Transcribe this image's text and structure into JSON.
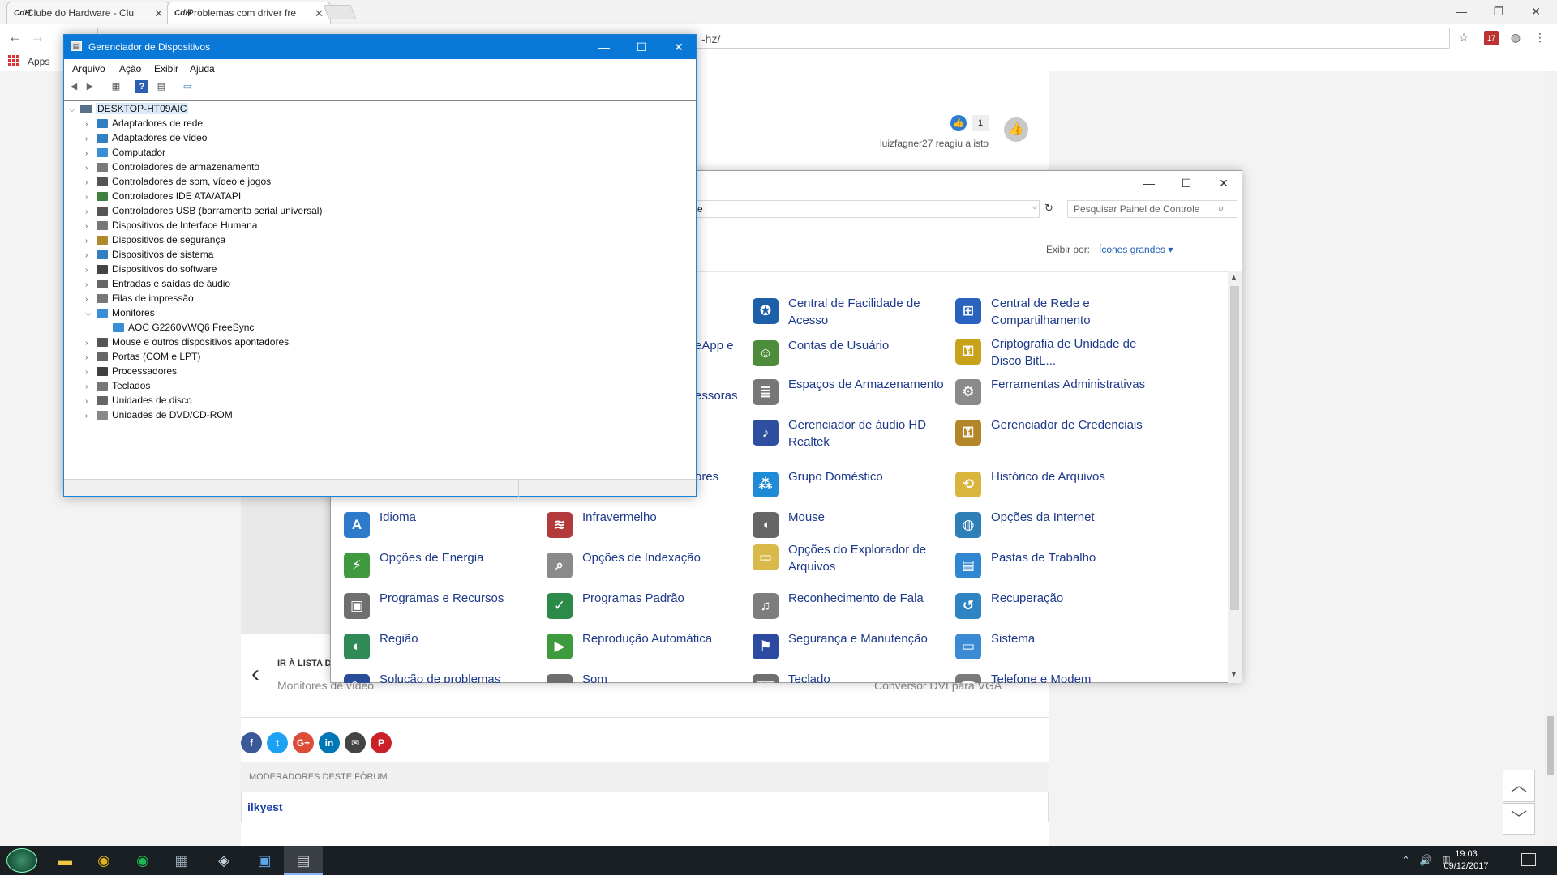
{
  "browser": {
    "tabs": [
      {
        "favicon": "CdH",
        "label": "Clube do Hardware - Clu"
      },
      {
        "favicon": "CdH",
        "label": "Problemas com driver fre"
      }
    ],
    "url_tail": "-hz/",
    "bookmarks_apps": "Apps",
    "extension_badge": "17"
  },
  "forum": {
    "reaction_count": "1",
    "reaction_text": "luizfagner27 reagiu a isto",
    "prev_label": "IR À LISTA D",
    "prev_link": "Monitores de vídeo",
    "next_link": "Conversor DVI para VGA",
    "moderators_header": "MODERADORES DESTE FÓRUM",
    "moderator_user": "ilkyest",
    "social_buttons": [
      {
        "icon": "facebook-icon",
        "glyph": "f",
        "color": "#3b5998"
      },
      {
        "icon": "twitter-icon",
        "glyph": "t",
        "color": "#1da1f2"
      },
      {
        "icon": "google-plus-icon",
        "glyph": "G+",
        "color": "#dd4b39"
      },
      {
        "icon": "linkedin-icon",
        "glyph": "in",
        "color": "#0077b5"
      },
      {
        "icon": "email-icon",
        "glyph": "✉",
        "color": "#444444"
      },
      {
        "icon": "pinterest-icon",
        "glyph": "P",
        "color": "#cb2027"
      }
    ]
  },
  "control_panel": {
    "address_fragment": "e",
    "search_placeholder": "Pesquisar Painel de Controle",
    "view_by_label": "Exibir por:",
    "view_by_value": "Ícones grandes",
    "partial_items": [
      "eApp e",
      "essoras",
      "ores"
    ],
    "items": [
      {
        "label": "Central de Facilidade de Acesso",
        "icon": "ease-of-access-icon",
        "glyph": "✪",
        "color": "#1d5fa8"
      },
      {
        "label": "Central de Rede e Compartilhamento",
        "icon": "network-center-icon",
        "glyph": "⊞",
        "color": "#2a62c0"
      },
      {
        "label": "Contas de Usuário",
        "icon": "user-accounts-icon",
        "glyph": "☺",
        "color": "#4d8c3b"
      },
      {
        "label": "Criptografia de Unidade de Disco BitL...",
        "icon": "bitlocker-icon",
        "glyph": "⚿",
        "color": "#c9a21c"
      },
      {
        "label": "Espaços de Armazenamento",
        "icon": "storage-spaces-icon",
        "glyph": "≣",
        "color": "#777777"
      },
      {
        "label": "Ferramentas Administrativas",
        "icon": "admin-tools-icon",
        "glyph": "⚙",
        "color": "#8a8a8a"
      },
      {
        "label": "Gerenciador de áudio HD Realtek",
        "icon": "realtek-audio-icon",
        "glyph": "♪",
        "color": "#2e4fa0"
      },
      {
        "label": "Gerenciador de Credenciais",
        "icon": "credential-manager-icon",
        "glyph": "⚿",
        "color": "#b3862a"
      },
      {
        "label": "Grupo Doméstico",
        "icon": "homegroup-icon",
        "glyph": "⁂",
        "color": "#1f8ad6"
      },
      {
        "label": "Histórico de Arquivos",
        "icon": "file-history-icon",
        "glyph": "⟲",
        "color": "#d9b53d"
      },
      {
        "label": "Idioma",
        "icon": "language-icon",
        "glyph": "A",
        "color": "#2c7ac9"
      },
      {
        "label": "Infravermelho",
        "icon": "infrared-icon",
        "glyph": "≋",
        "color": "#b23a3a"
      },
      {
        "label": "Mouse",
        "icon": "mouse-icon",
        "glyph": "◖",
        "color": "#666666"
      },
      {
        "label": "Opções da Internet",
        "icon": "internet-options-icon",
        "glyph": "◍",
        "color": "#2e7fb8"
      },
      {
        "label": "Opções de Energia",
        "icon": "power-options-icon",
        "glyph": "⚡",
        "color": "#3f9a3f"
      },
      {
        "label": "Opções de Indexação",
        "icon": "indexing-options-icon",
        "glyph": "⌕",
        "color": "#8a8a8a"
      },
      {
        "label": "Opções do Explorador de Arquivos",
        "icon": "file-explorer-options-icon",
        "glyph": "▭",
        "color": "#d8b94a"
      },
      {
        "label": "Pastas de Trabalho",
        "icon": "work-folders-icon",
        "glyph": "▤",
        "color": "#2f86d1"
      },
      {
        "label": "Programas e Recursos",
        "icon": "programs-features-icon",
        "glyph": "▣",
        "color": "#6f6f6f"
      },
      {
        "label": "Programas Padrão",
        "icon": "default-programs-icon",
        "glyph": "✓",
        "color": "#2d8b4a"
      },
      {
        "label": "Reconhecimento de Fala",
        "icon": "speech-recognition-icon",
        "glyph": "♫",
        "color": "#7d7d7d"
      },
      {
        "label": "Recuperação",
        "icon": "recovery-icon",
        "glyph": "↺",
        "color": "#2f84c4"
      },
      {
        "label": "Região",
        "icon": "region-icon",
        "glyph": "◐",
        "color": "#2f8a56"
      },
      {
        "label": "Reprodução Automática",
        "icon": "autoplay-icon",
        "glyph": "▶",
        "color": "#3d9a3d"
      },
      {
        "label": "Segurança e Manutenção",
        "icon": "security-maintenance-icon",
        "glyph": "⚑",
        "color": "#2b4aa0"
      },
      {
        "label": "Sistema",
        "icon": "system-icon",
        "glyph": "▭",
        "color": "#3a8bd4"
      },
      {
        "label": "Solução de problemas",
        "icon": "troubleshooting-icon",
        "glyph": "✎",
        "color": "#2a4d9a"
      },
      {
        "label": "Som",
        "icon": "sound-icon",
        "glyph": "◔",
        "color": "#6d6d6d"
      },
      {
        "label": "Teclado",
        "icon": "keyboard-icon",
        "glyph": "⌨",
        "color": "#6f6f6f"
      },
      {
        "label": "Telefone e Modem",
        "icon": "phone-modem-icon",
        "glyph": "☎",
        "color": "#7a7a7a"
      }
    ]
  },
  "device_manager": {
    "title": "Gerenciador de Dispositivos",
    "menu": [
      "Arquivo",
      "Ação",
      "Exibir",
      "Ajuda"
    ],
    "tree": [
      {
        "label": "DESKTOP-HT09AIC",
        "level": 0,
        "expander": "⌵",
        "icon_color": "#5a6f8a"
      },
      {
        "label": "Adaptadores de rede",
        "level": 1,
        "expander": "›",
        "icon_color": "#2f7fc1"
      },
      {
        "label": "Adaptadores de vídeo",
        "level": 1,
        "expander": "›",
        "icon_color": "#2f7fc1"
      },
      {
        "label": "Computador",
        "level": 1,
        "expander": "›",
        "icon_color": "#3a8ed6"
      },
      {
        "label": "Controladores de armazenamento",
        "level": 1,
        "expander": "›",
        "icon_color": "#7a7a7a"
      },
      {
        "label": "Controladores de som, vídeo e jogos",
        "level": 1,
        "expander": "›",
        "icon_color": "#555555"
      },
      {
        "label": "Controladores IDE ATA/ATAPI",
        "level": 1,
        "expander": "›",
        "icon_color": "#3f7f3f"
      },
      {
        "label": "Controladores USB (barramento serial universal)",
        "level": 1,
        "expander": "›",
        "icon_color": "#555555"
      },
      {
        "label": "Dispositivos de Interface Humana",
        "level": 1,
        "expander": "›",
        "icon_color": "#777777"
      },
      {
        "label": "Dispositivos de segurança",
        "level": 1,
        "expander": "›",
        "icon_color": "#b08a2a"
      },
      {
        "label": "Dispositivos de sistema",
        "level": 1,
        "expander": "›",
        "icon_color": "#2f7fc1"
      },
      {
        "label": "Dispositivos do software",
        "level": 1,
        "expander": "›",
        "icon_color": "#444444"
      },
      {
        "label": "Entradas e saídas de áudio",
        "level": 1,
        "expander": "›",
        "icon_color": "#666666"
      },
      {
        "label": "Filas de impressão",
        "level": 1,
        "expander": "›",
        "icon_color": "#777777"
      },
      {
        "label": "Monitores",
        "level": 1,
        "expander": "⌵",
        "icon_color": "#3a8ed6"
      },
      {
        "label": "AOC G2260VWQ6 FreeSync",
        "level": 2,
        "expander": "",
        "icon_color": "#3a8ed6"
      },
      {
        "label": "Mouse e outros dispositivos apontadores",
        "level": 1,
        "expander": "›",
        "icon_color": "#555555"
      },
      {
        "label": "Portas (COM e LPT)",
        "level": 1,
        "expander": "›",
        "icon_color": "#666666"
      },
      {
        "label": "Processadores",
        "level": 1,
        "expander": "›",
        "icon_color": "#3f3f3f"
      },
      {
        "label": "Teclados",
        "level": 1,
        "expander": "›",
        "icon_color": "#777777"
      },
      {
        "label": "Unidades de disco",
        "level": 1,
        "expander": "›",
        "icon_color": "#666666"
      },
      {
        "label": "Unidades de DVD/CD-ROM",
        "level": 1,
        "expander": "›",
        "icon_color": "#888888"
      }
    ]
  },
  "taskbar": {
    "time": "19:03",
    "date": "09/12/2017",
    "apps": [
      {
        "icon": "file-explorer-icon",
        "glyph": "▬",
        "color": "#f2c744"
      },
      {
        "icon": "chrome-icon",
        "glyph": "◉",
        "color": "#e0b021"
      },
      {
        "icon": "spotify-icon",
        "glyph": "◉",
        "color": "#1db954"
      },
      {
        "icon": "gpu-tool-icon",
        "glyph": "▦",
        "color": "#9aa7b5"
      },
      {
        "icon": "steam-icon",
        "glyph": "◈",
        "color": "#c7d5e0"
      },
      {
        "icon": "control-panel-icon",
        "glyph": "▣",
        "color": "#5fa6e8"
      },
      {
        "icon": "device-manager-icon",
        "glyph": "▤",
        "color": "#c8c8c8"
      }
    ]
  }
}
